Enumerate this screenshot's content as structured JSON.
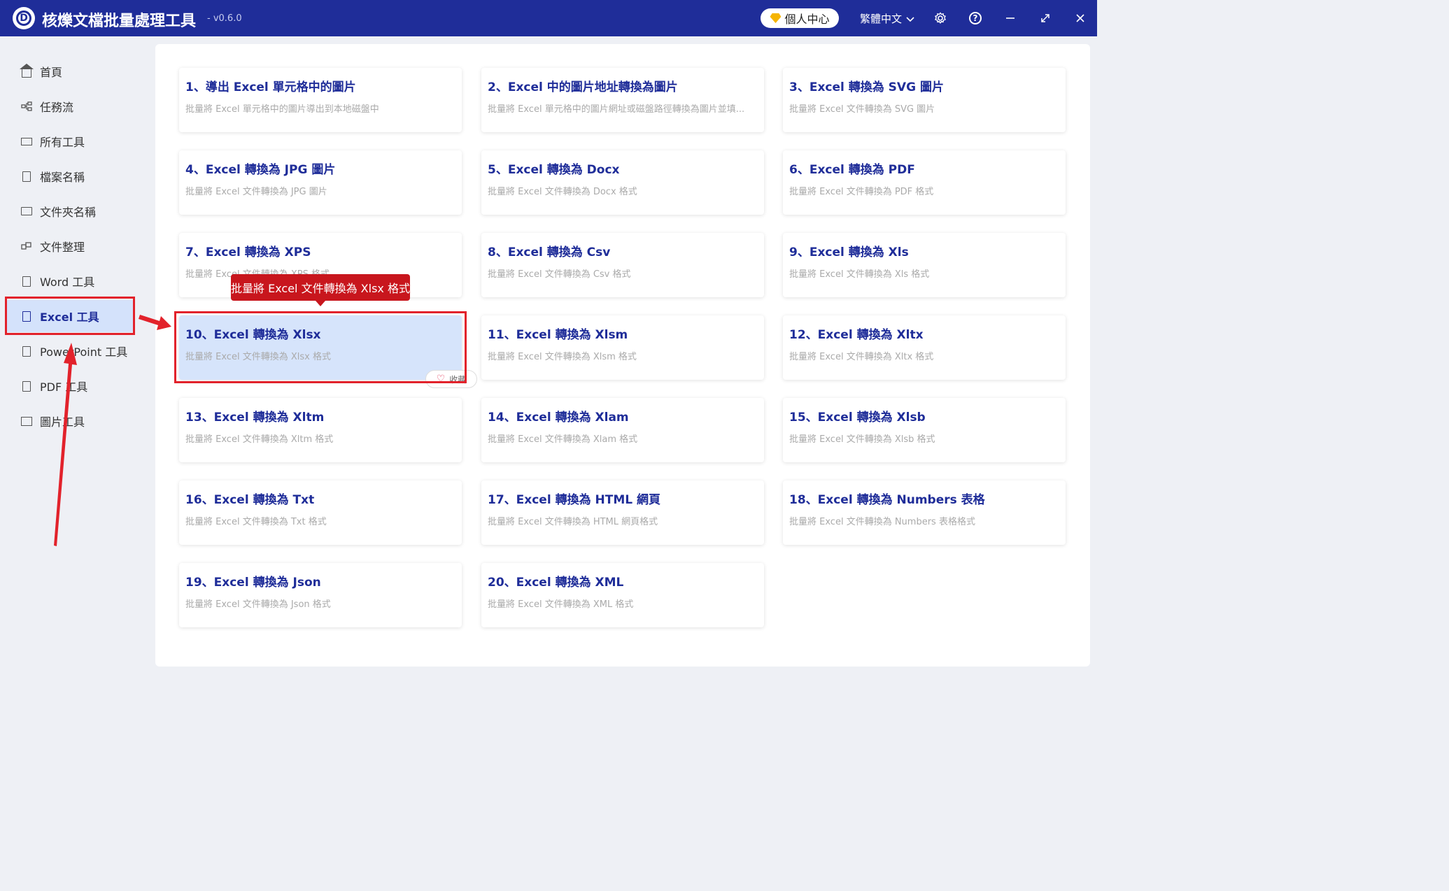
{
  "app": {
    "title": "核爍文檔批量處理工具",
    "version": "- v0.6.0",
    "logo_letter": "D",
    "user_center": "個人中心",
    "language": "繁體中文"
  },
  "sidebar": {
    "items": [
      {
        "label": "首頁",
        "icon": "home-icon"
      },
      {
        "label": "任務流",
        "icon": "workflow-icon"
      },
      {
        "label": "所有工具",
        "icon": "monitor-icon"
      },
      {
        "label": "檔案名稱",
        "icon": "file-name-icon"
      },
      {
        "label": "文件夾名稱",
        "icon": "folder-icon"
      },
      {
        "label": "文件整理",
        "icon": "organize-icon"
      },
      {
        "label": "Word 工具",
        "icon": "word-icon"
      },
      {
        "label": "Excel 工具",
        "icon": "excel-icon"
      },
      {
        "label": "PowerPoint 工具",
        "icon": "powerpoint-icon"
      },
      {
        "label": "PDF 工具",
        "icon": "pdf-icon"
      },
      {
        "label": "圖片工具",
        "icon": "image-icon"
      }
    ],
    "active_index": 7
  },
  "tools": [
    {
      "title": "1、導出 Excel 單元格中的圖片",
      "desc": "批量將 Excel 單元格中的圖片導出到本地磁盤中"
    },
    {
      "title": "2、Excel 中的圖片地址轉換為圖片",
      "desc": "批量將 Excel 單元格中的圖片網址或磁盤路徑轉換為圖片並填..."
    },
    {
      "title": "3、Excel 轉換為 SVG 圖片",
      "desc": "批量將 Excel 文件轉換為 SVG 圖片"
    },
    {
      "title": "4、Excel 轉換為 JPG 圖片",
      "desc": "批量將 Excel 文件轉換為 JPG 圖片"
    },
    {
      "title": "5、Excel 轉換為 Docx",
      "desc": "批量將 Excel 文件轉換為 Docx 格式"
    },
    {
      "title": "6、Excel 轉換為 PDF",
      "desc": "批量將 Excel 文件轉換為 PDF 格式"
    },
    {
      "title": "7、Excel 轉換為 XPS",
      "desc": "批量將 Excel 文件轉換為 XPS 格式"
    },
    {
      "title": "8、Excel 轉換為 Csv",
      "desc": "批量將 Excel 文件轉換為 Csv 格式"
    },
    {
      "title": "9、Excel 轉換為 Xls",
      "desc": "批量將 Excel 文件轉換為 Xls 格式"
    },
    {
      "title": "10、Excel 轉換為 Xlsx",
      "desc": "批量將 Excel 文件轉換為 Xlsx 格式"
    },
    {
      "title": "11、Excel 轉換為 Xlsm",
      "desc": "批量將 Excel 文件轉換為 Xlsm 格式"
    },
    {
      "title": "12、Excel 轉換為 Xltx",
      "desc": "批量將 Excel 文件轉換為 Xltx 格式"
    },
    {
      "title": "13、Excel 轉換為 Xltm",
      "desc": "批量將 Excel 文件轉換為 Xltm 格式"
    },
    {
      "title": "14、Excel 轉換為 Xlam",
      "desc": "批量將 Excel 文件轉換為 Xlam 格式"
    },
    {
      "title": "15、Excel 轉換為 Xlsb",
      "desc": "批量將 Excel 文件轉換為 Xlsb 格式"
    },
    {
      "title": "16、Excel 轉換為 Txt",
      "desc": "批量將 Excel 文件轉換為 Txt 格式"
    },
    {
      "title": "17、Excel 轉換為 HTML 網頁",
      "desc": "批量將 Excel 文件轉換為 HTML 網頁格式"
    },
    {
      "title": "18、Excel 轉換為 Numbers 表格",
      "desc": "批量將 Excel 文件轉換為 Numbers 表格格式"
    },
    {
      "title": "19、Excel 轉換為 Json",
      "desc": "批量將 Excel 文件轉換為 Json 格式"
    },
    {
      "title": "20、Excel 轉換為 XML",
      "desc": "批量將 Excel 文件轉換為 XML 格式"
    }
  ],
  "highlighted_tool_index": 9,
  "tooltip": "批量將 Excel 文件轉換為 Xlsx 格式",
  "favorite_label": "收藏",
  "colors": {
    "titlebar": "#1f2d99",
    "accent": "#1f2d99",
    "highlight_bg": "#d6e4fb",
    "annotation_red": "#e2222b",
    "tooltip_red": "#c8161d"
  }
}
